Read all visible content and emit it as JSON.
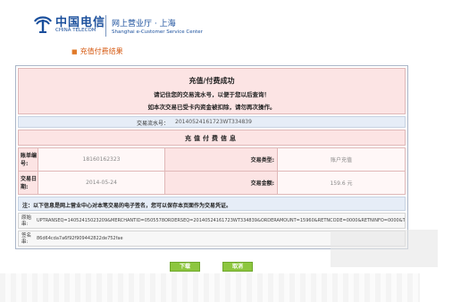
{
  "header": {
    "logo_cn": "中国电信",
    "logo_en": "CHINA TELECOM",
    "hall_cn": "网上营业厅 · 上海",
    "hall_en": "Shanghai e-Customer Service Center",
    "brand_color": "#1a4f9c"
  },
  "breadcrumb": {
    "bullet": "■",
    "label": "充值付费结果"
  },
  "success": {
    "title": "充值/付费成功",
    "line1": "请记住您的交易流水号，以便于您以后查询！",
    "line2": "如本次交易已受卡内资金被扣除，请勿再次操作。"
  },
  "serial": {
    "label": "交易流水号：",
    "value": "20140524161723WT334839"
  },
  "info": {
    "heading": "充值付费信息",
    "rows": [
      {
        "label": "账单编号:",
        "value": "18160162323",
        "label2": "交易类型:",
        "value2": "账户充值"
      },
      {
        "label": "交易日期:",
        "value": "2014-05-24",
        "label2": "交易金额:",
        "value2": "159.6 元"
      }
    ]
  },
  "note": "注：以下信息是网上营业中心对本笔交易的电子签名，您可以保存本页面作为交易凭证。",
  "raw": {
    "label": "原始串:",
    "value": "UPTRANSEQ=14052415023209&MERCHANTID=0505578ORDERSEQ=20140524161723WT334839&ORDERAMOUNT=15960&RETNCODE=0000&RETNINFO=0000&TRANDATE="
  },
  "signature": {
    "label": "签名串:",
    "value": "86d64cda7a6f92f909442822de752fae"
  },
  "buttons": {
    "download": "下载",
    "cancel": "取消",
    "color": "#8dc63f"
  },
  "colors": {
    "pink": "#fce4e4",
    "blue": "#e6edf7",
    "accent": "#d65a12"
  }
}
